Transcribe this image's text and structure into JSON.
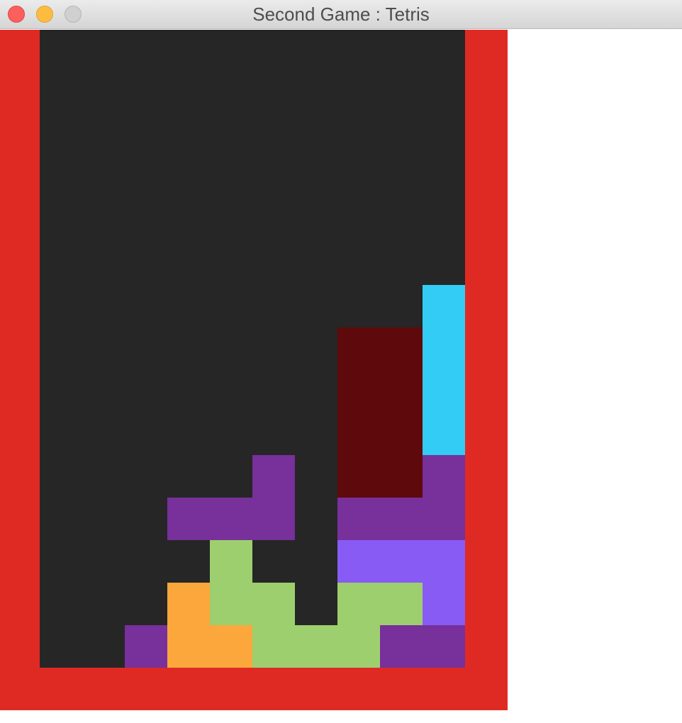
{
  "window": {
    "title": "Second Game : Tetris"
  },
  "colors": {
    "frame": "#df2a24",
    "board_bg": "#262626",
    "I": "#33ccf5",
    "O": "#5e090c",
    "T": "#78309b",
    "S": "#9ecf6e",
    "L": "#fba73c",
    "Z": "#885bf4"
  },
  "board": {
    "columns": 10,
    "rows": 15,
    "cells": [
      {
        "row": 6,
        "col": 9,
        "piece": "I"
      },
      {
        "row": 7,
        "col": 7,
        "piece": "O"
      },
      {
        "row": 7,
        "col": 8,
        "piece": "O"
      },
      {
        "row": 7,
        "col": 9,
        "piece": "I"
      },
      {
        "row": 8,
        "col": 7,
        "piece": "O"
      },
      {
        "row": 8,
        "col": 8,
        "piece": "O"
      },
      {
        "row": 8,
        "col": 9,
        "piece": "I"
      },
      {
        "row": 9,
        "col": 7,
        "piece": "O"
      },
      {
        "row": 9,
        "col": 8,
        "piece": "O"
      },
      {
        "row": 9,
        "col": 9,
        "piece": "I"
      },
      {
        "row": 10,
        "col": 5,
        "piece": "T"
      },
      {
        "row": 10,
        "col": 7,
        "piece": "O"
      },
      {
        "row": 10,
        "col": 8,
        "piece": "O"
      },
      {
        "row": 10,
        "col": 9,
        "piece": "T"
      },
      {
        "row": 11,
        "col": 3,
        "piece": "T"
      },
      {
        "row": 11,
        "col": 4,
        "piece": "T"
      },
      {
        "row": 11,
        "col": 5,
        "piece": "T"
      },
      {
        "row": 11,
        "col": 7,
        "piece": "T"
      },
      {
        "row": 11,
        "col": 8,
        "piece": "T"
      },
      {
        "row": 11,
        "col": 9,
        "piece": "T"
      },
      {
        "row": 12,
        "col": 4,
        "piece": "S"
      },
      {
        "row": 12,
        "col": 7,
        "piece": "Z"
      },
      {
        "row": 12,
        "col": 8,
        "piece": "Z"
      },
      {
        "row": 12,
        "col": 9,
        "piece": "Z"
      },
      {
        "row": 13,
        "col": 3,
        "piece": "L"
      },
      {
        "row": 13,
        "col": 4,
        "piece": "S"
      },
      {
        "row": 13,
        "col": 5,
        "piece": "S"
      },
      {
        "row": 13,
        "col": 7,
        "piece": "S"
      },
      {
        "row": 13,
        "col": 8,
        "piece": "S"
      },
      {
        "row": 13,
        "col": 9,
        "piece": "Z"
      },
      {
        "row": 14,
        "col": 2,
        "piece": "T"
      },
      {
        "row": 14,
        "col": 3,
        "piece": "L"
      },
      {
        "row": 14,
        "col": 4,
        "piece": "L"
      },
      {
        "row": 14,
        "col": 5,
        "piece": "S"
      },
      {
        "row": 14,
        "col": 6,
        "piece": "S"
      },
      {
        "row": 14,
        "col": 7,
        "piece": "S"
      },
      {
        "row": 14,
        "col": 8,
        "piece": "T"
      },
      {
        "row": 14,
        "col": 9,
        "piece": "T"
      }
    ]
  }
}
